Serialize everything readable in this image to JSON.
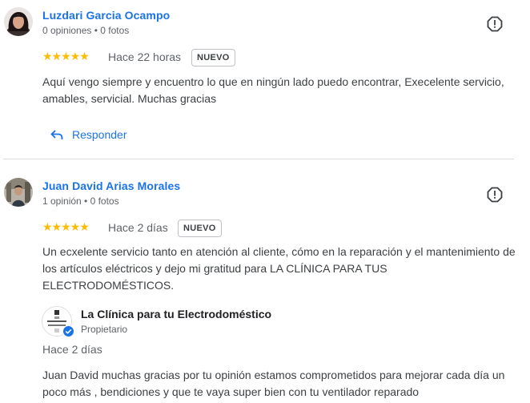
{
  "reviews": [
    {
      "author": "Luzdari Garcia Ocampo",
      "meta": "0 opiniones • 0 fotos",
      "stars": "★★★★★",
      "rating": 5,
      "date": "Hace 22 horas",
      "badge": "NUEVO",
      "text": "Aquí vengo siempre y encuentro lo que en ningún lado puedo encontrar, Execelente servicio, amables, servicial. Muchas gracias",
      "reply_label": "Responder"
    },
    {
      "author": "Juan David Arias Morales",
      "meta": "1 opinión • 0 fotos",
      "stars": "★★★★★",
      "rating": 5,
      "date": "Hace 2 días",
      "badge": "NUEVO",
      "text": "Un ecxelente servicio tanto en atención al cliente, cómo en la reparación y el mantenimiento de los artículos eléctricos y dejo mi gratitud para LA CLÍNICA PARA TUS ELECTRODOMÉSTICOS.",
      "owner_reply": {
        "name": "La Clínica para tu Electrodoméstico",
        "role": "Propietario",
        "date": "Hace 2 días",
        "text": "Juan David muchas gracias por tu opinión estamos comprometidos para mejorar cada día un poco más , bendiciones y que te vaya super bien con tu ventilador reparado"
      }
    }
  ],
  "colors": {
    "link": "#1a73e8",
    "star": "#fbbc04",
    "divider": "#dadce0"
  }
}
